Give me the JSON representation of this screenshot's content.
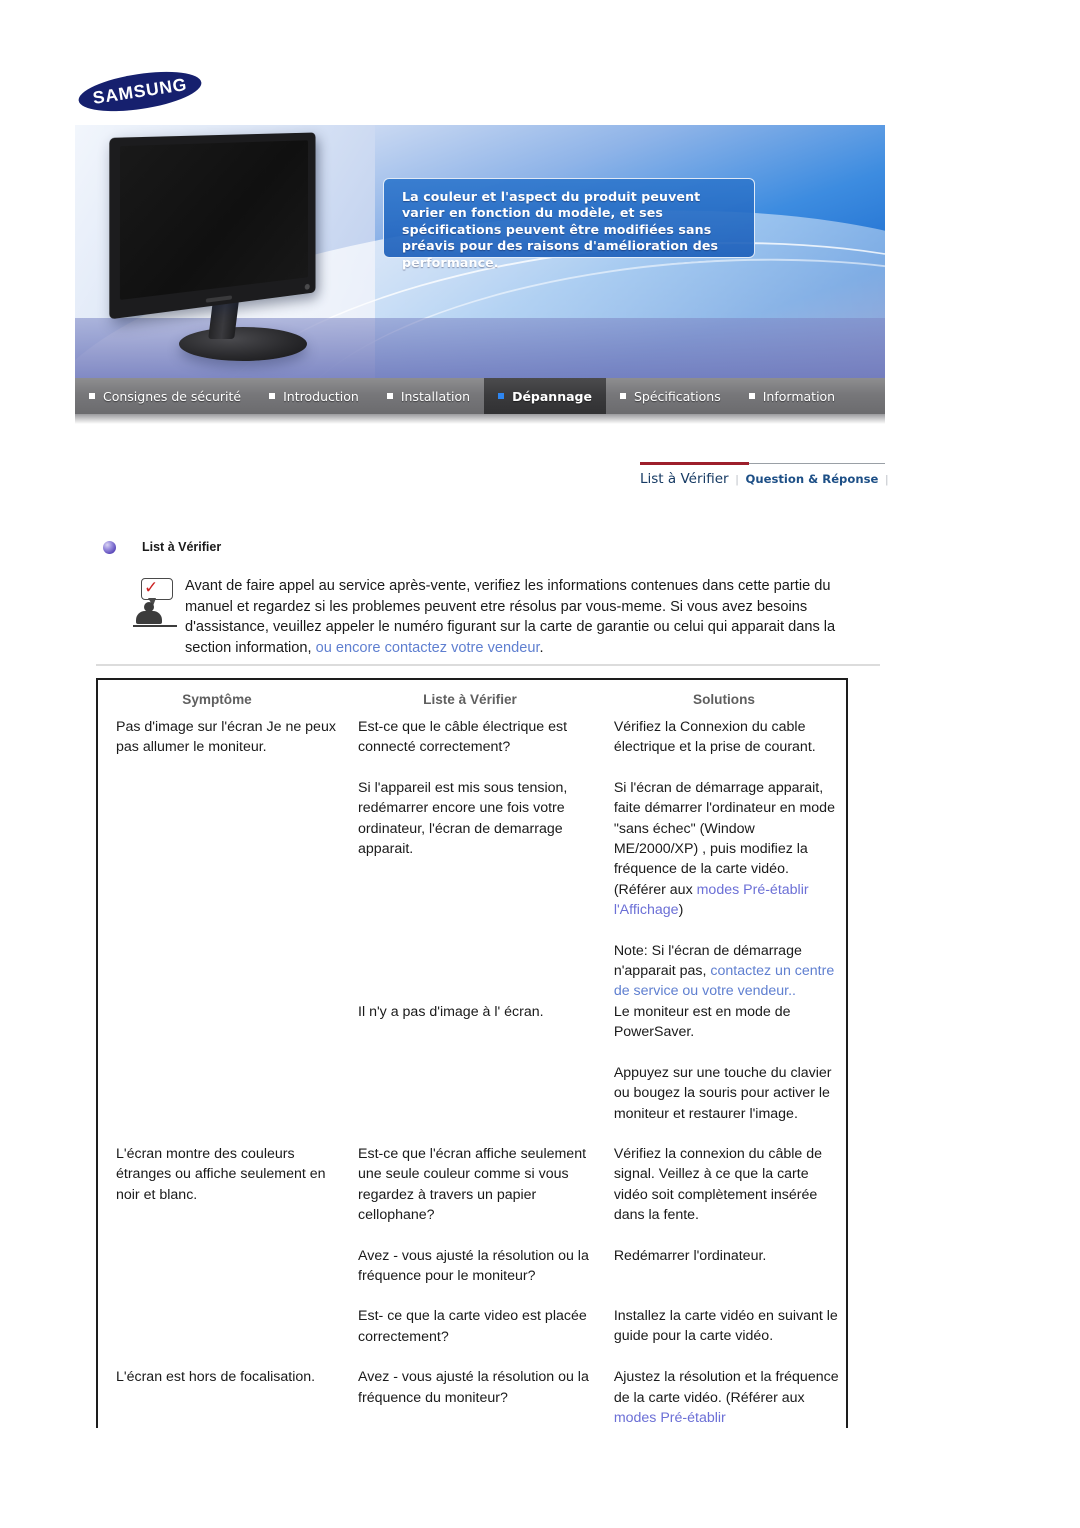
{
  "brand": {
    "name": "SAMSUNG",
    "logo_color": "#16206e"
  },
  "hero": {
    "callout": "La couleur et l'aspect du produit peuvent varier en fonction du modèle, et ses spécifications peuvent être modifiées sans préavis pour des raisons d'amélioration des performance.",
    "product": "monitor-illustration"
  },
  "mainnav": {
    "items": [
      {
        "label": "Consignes de sécurité",
        "active": false
      },
      {
        "label": "Introduction",
        "active": false
      },
      {
        "label": "Installation",
        "active": false
      },
      {
        "label": "Dépannage",
        "active": true
      },
      {
        "label": "Spécifications",
        "active": false
      },
      {
        "label": "Information",
        "active": false
      }
    ],
    "active_accent": "#2e86f0"
  },
  "subnav": {
    "items": [
      {
        "label": "List à Vérifier",
        "active": true
      },
      {
        "label": "Question & Réponse",
        "active": false
      }
    ],
    "separator": "|",
    "rule_color": "#9d1f2b"
  },
  "section": {
    "heading": "List à Vérifier",
    "intro_part1": "Avant de faire appel au service après-vente, verifiez les informations contenues dans cette partie du manuel et regardez si les problemes peuvent etre résolus par vous-meme. Si vous avez besoins d'assistance, veuillez appeler le numéro figurant sur la carte de garantie ou celui qui apparait dans la section information, ",
    "intro_link": "ou encore contactez votre vendeur",
    "intro_end": "."
  },
  "table": {
    "headers": [
      "Symptôme",
      "Liste à Vérifier",
      "Solutions"
    ],
    "rows": [
      {
        "symptom": "Pas d'image sur l'écran Je ne peux pas allumer le moniteur.",
        "checks": [
          "Est-ce que le câble électrique est connecté correctement?",
          "Si l'appareil est mis sous tension, redémarrer encore une fois votre ordinateur, l'écran de demarrage apparait.",
          "Il n'y a pas d'image à l' écran."
        ],
        "solutions": [
          {
            "text": "Vérifiez la Connexion du cable électrique et la prise de courant."
          },
          {
            "text": "Si l'écran de démarrage apparait, faite démarrer l'ordinateur en mode \"sans échec\" (Window ME/2000/XP) , puis modifiez la fréquence de la carte vidéo. (Référer aux ",
            "link": "modes Pré-établir l'Affichage",
            "tail": ")"
          },
          {
            "text": "Note: Si l'écran de démarrage n'apparait pas, ",
            "link": "contactez un centre de service ou votre vendeur",
            "tail": ".."
          },
          {
            "text": "Le moniteur est en mode de PowerSaver."
          },
          {
            "text": "Appuyez sur une touche du clavier ou bougez la souris pour activer le moniteur et restaurer l'image."
          }
        ]
      },
      {
        "symptom": "L'écran montre des couleurs étranges ou affiche seulement en noir et blanc.",
        "checks": [
          "Est-ce que l'écran affiche seulement une seule couleur comme si vous regardez à travers un papier cellophane?",
          "Avez - vous ajusté la résolution ou la fréquence pour le moniteur?",
          "Est- ce que la carte video est placée correctement?"
        ],
        "solutions": [
          {
            "text": "Vérifiez la connexion du câble de signal. Veillez à ce que la carte vidéo soit complètement insérée dans la fente."
          },
          {
            "text": "Redémarrer l'ordinateur."
          },
          {
            "text": "Installez la carte vidéo en suivant le guide pour la carte vidéo."
          }
        ]
      },
      {
        "symptom": "L'écran est hors de focalisation.",
        "checks": [
          "Avez - vous ajusté la résolution ou la fréquence du moniteur?"
        ],
        "solutions": [
          {
            "text": "Ajustez la résolution et la fréquence de la carte vidéo. (Référer aux ",
            "link": "modes Pré-établir"
          }
        ]
      }
    ]
  }
}
